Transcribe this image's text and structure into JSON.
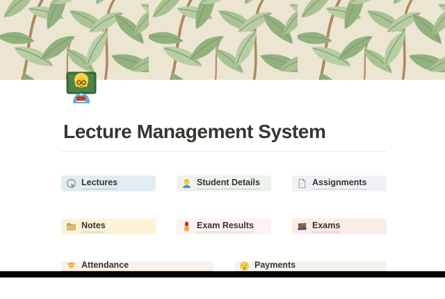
{
  "page": {
    "title": "Lecture Management System",
    "icon": "woman-teacher-emoji",
    "cover": "willow-leaf-pattern"
  },
  "cards": [
    {
      "label": "Lectures",
      "icon": "globe-icon",
      "bg": "#e1edf3"
    },
    {
      "label": "Student Details",
      "icon": "student-icon",
      "bg": "#edf2ec"
    },
    {
      "label": "Assignments",
      "icon": "page-icon",
      "bg": "#f3f1f6"
    },
    {
      "label": "Notes",
      "icon": "folder-icon",
      "bg": "#faf3da"
    },
    {
      "label": "Exam Results",
      "icon": "medal-icon",
      "bg": "#fdf3f3"
    },
    {
      "label": "Exams",
      "icon": "books-icon",
      "bg": "#fcebe9"
    },
    {
      "label": "Attendance",
      "icon": "person-raising-hand-icon",
      "bg": "#f4f3f0",
      "edge": "#f0b4ae"
    },
    {
      "label": "Payments",
      "icon": "money-face-icon",
      "bg": "#f4f3f0",
      "edge": "#d9d8d4"
    }
  ],
  "colors": {
    "title_text": "#37352f",
    "divider": "#e9e9e7",
    "cover_background": "#ebe5d2",
    "cover_leaf_light": "#b9cda4",
    "cover_leaf_mid": "#a9c193",
    "cover_leaf_dark": "#93b17e",
    "cover_branch": "#aa8a61",
    "bottom_bar": "#000000"
  }
}
